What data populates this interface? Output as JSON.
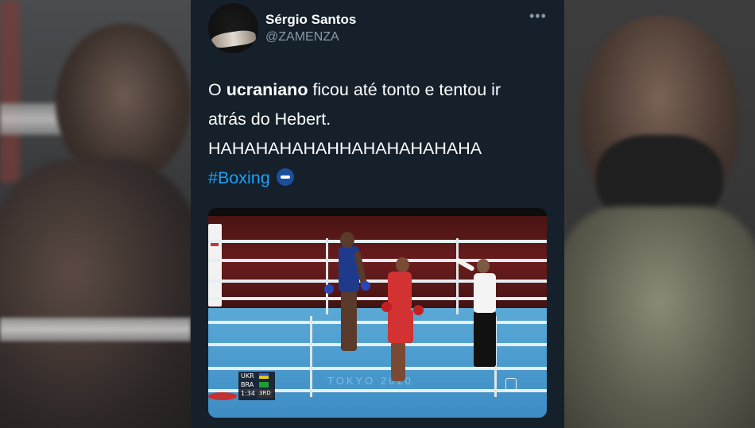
{
  "tweet": {
    "display_name": "Sérgio Santos",
    "handle": "@ZAMENZA",
    "more_label": "•••",
    "text_prefix": "O ",
    "text_bold": "ucraniano",
    "text_line1_rest": " ficou até tonto e tentou ir",
    "text_line2": "atrás do Hebert.",
    "text_line3": "HAHAHAHAHAHHAHAHAHAHAHA",
    "hashtag": "#Boxing"
  },
  "video": {
    "scoreboard": {
      "row1_country": "UKR",
      "row2_country": "BRA",
      "time": "1:34",
      "round": "3RD"
    },
    "floor_text": "TOKYO 2020",
    "boxer_blue_label": "BRA"
  },
  "colors": {
    "tweet_bg": "#15202b",
    "hashtag": "#1da1f2",
    "secondary_text": "#8899a6"
  }
}
